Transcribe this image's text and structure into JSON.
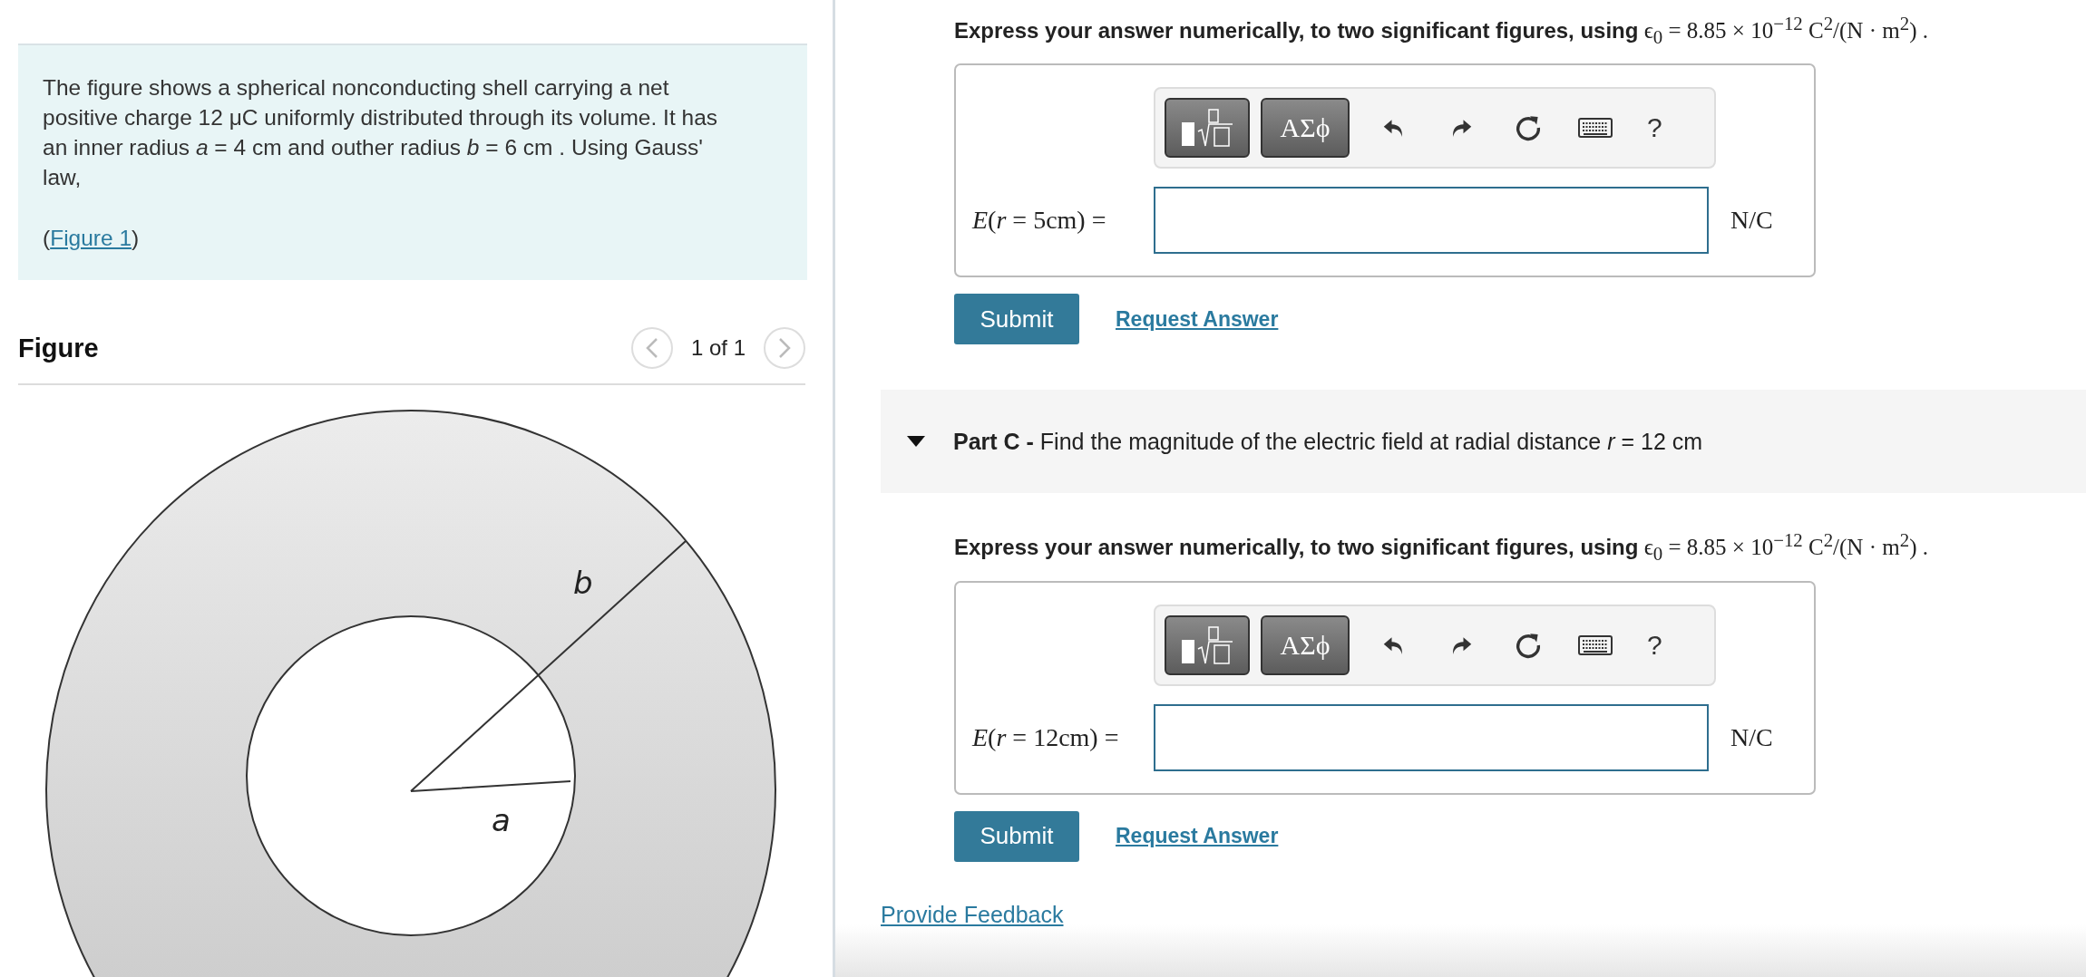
{
  "problem": {
    "text": "The figure shows a spherical nonconducting shell carrying a net positive charge 12 μC uniformly distributed through its volume. It has an inner radius *a* = 4 cm and outher radius *b* = 6 cm . Using Gauss' law,",
    "figure_reference": {
      "before": "(",
      "link": "Figure 1",
      "after": ")"
    }
  },
  "figure": {
    "title": "Figure",
    "pager": "1 of 1",
    "labels": [
      "b",
      "a"
    ]
  },
  "parts": [
    {
      "instruction": "**Express your answer numerically, to two significant figures, using** ϵ$_{0}$ = 8.85 × 10$^{−12}$ C$^{2}$/(N · m$^{2}$) .",
      "toolbar": {
        "symbols_button": "ΑΣϕ",
        "help_button": "?"
      },
      "answer_label": "*E*(*r* = 5cm) =",
      "unit": "N/C",
      "submit": "Submit",
      "request": "Request Answer"
    },
    {
      "header": {
        "expanded": true,
        "text": "**Part C -** Find the magnitude of the electric field at radial distance *r* = 12 cm"
      },
      "instruction": "**Express your answer numerically, to two significant figures, using** ϵ$_{0}$ = 8.85 × 10$^{−12}$ C$^{2}$/(N · m$^{2}$) .",
      "toolbar": {
        "symbols_button": "ΑΣϕ",
        "help_button": "?"
      },
      "answer_label": "*E*(*r* = 12cm) =",
      "unit": "N/C",
      "submit": "Submit",
      "request": "Request Answer"
    }
  ],
  "feedback_link": "Provide Feedback"
}
